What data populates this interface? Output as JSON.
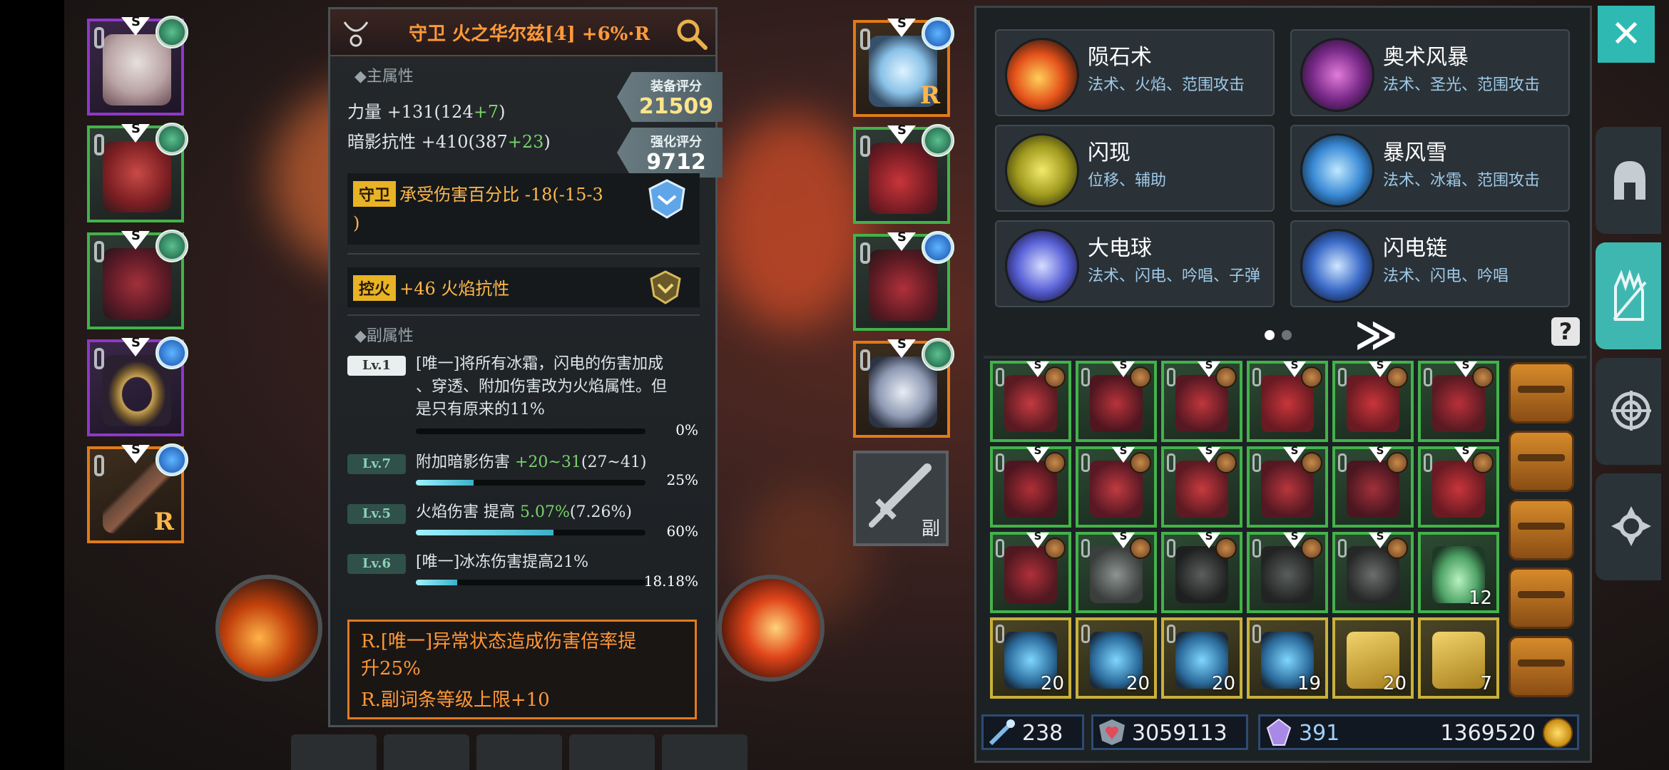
{
  "detail": {
    "title": "守卫 火之华尔兹[4] +6%·R",
    "main_attr_head": "◆主属性",
    "main_stats": [
      {
        "label": "力量 +131(124",
        "bonus": "+7",
        "end": ")"
      },
      {
        "label": "暗影抗性 +410(387",
        "bonus": "+23",
        "end": ")"
      }
    ],
    "score_label": "装备评分",
    "score_value": "21509",
    "enhance_label": "强化评分",
    "enhance_value": "9712",
    "affix1_tag": "守卫",
    "affix1_text": "承受伤害百分比 -18(-15-3",
    "affix1_text2": ")",
    "affix2_tag": "控火",
    "affix2_text": "+46 火焰抗性",
    "sub_attr_head": "◆副属性",
    "subs": [
      {
        "lv": "Lv.1",
        "line1": "[唯一]将所有冰霜，闪电的伤害加成",
        "line2": "、穿透、附加伤害改为火焰属性。但",
        "line3": "是只有原来的11%",
        "pct": "0%",
        "fill": 0
      },
      {
        "lv": "Lv.7",
        "line1": "附加暗影伤害 +20~31(27~41)",
        "pct": "25%",
        "fill": 0.25
      },
      {
        "lv": "Lv.5",
        "line1": "火焰伤害 提高 5.07%(7.26%)",
        "pct": "60%",
        "fill": 0.6
      },
      {
        "lv": "Lv.6",
        "line1": "[唯一]冰冻伤害提高21%",
        "pct": "18.18%",
        "fill": 0.18
      }
    ],
    "legend_line1": "R.[唯一]异常状态造成伤害倍率提",
    "legend_line2": "升25%",
    "legend_line3": "R.副词条等级上限+10"
  },
  "left_slots": [
    {
      "s": "S"
    },
    {
      "s": "S"
    },
    {
      "s": "S"
    },
    {
      "s": "S"
    },
    {
      "s": "S",
      "r": "R"
    }
  ],
  "right_slots": [
    {
      "s": "S",
      "r": "R"
    },
    {
      "s": "S"
    },
    {
      "s": "S"
    },
    {
      "s": "S"
    }
  ],
  "weapon_slot_label": "副",
  "skills": [
    {
      "name": "陨石术",
      "tags": "法术、火焰、范围攻击"
    },
    {
      "name": "奥术风暴",
      "tags": "法术、圣光、范围攻击"
    },
    {
      "name": "闪现",
      "tags": "位移、辅助"
    },
    {
      "name": "暴风雪",
      "tags": "法术、冰霜、范围攻击"
    },
    {
      "name": "大电球",
      "tags": "法术、闪电、吟唱、子弹"
    },
    {
      "name": "闪电链",
      "tags": "法术、闪电、吟唱"
    }
  ],
  "page_next": "≫",
  "help": "?",
  "close": "✕",
  "inventory_s": "S",
  "inventory_counts": [
    "12",
    "20",
    "20",
    "20",
    "19",
    "20",
    "7"
  ],
  "currencies": {
    "gem": "238",
    "shards": "3059113",
    "crystal": "391",
    "gold": "1369520"
  }
}
